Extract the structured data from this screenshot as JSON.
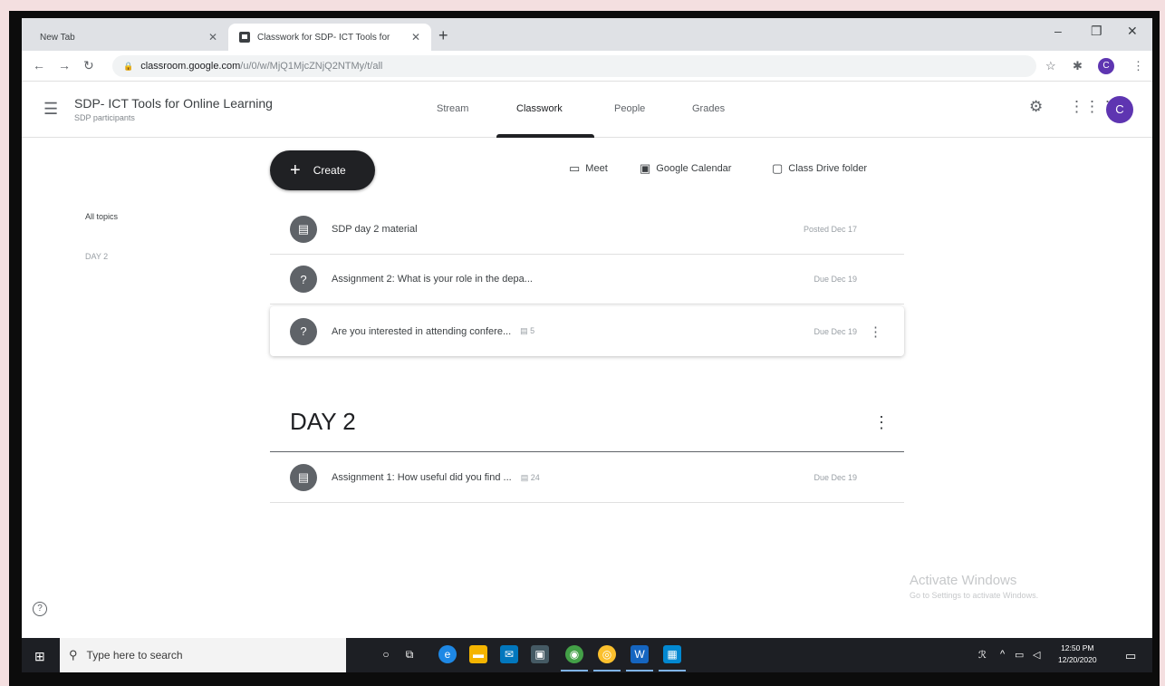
{
  "browser": {
    "tabs": [
      {
        "title": "New Tab"
      },
      {
        "title": "Classwork for SDP- ICT Tools for"
      }
    ],
    "url_host": "classroom.google.com",
    "url_path": "/u/0/w/MjQ1MjcZNjQ2NTMy/t/all",
    "profile_initial": "C",
    "window_controls": [
      "–",
      "❐",
      "✕"
    ]
  },
  "header": {
    "class_name": "SDP- ICT Tools for Online Learning",
    "subtitle": "SDP participants",
    "tabs": [
      "Stream",
      "Classwork",
      "People",
      "Grades"
    ],
    "active_tab": "Classwork",
    "avatar_initial": "C"
  },
  "toolbar": {
    "create_label": "Create",
    "meet_label": "Meet",
    "calendar_label": "Google Calendar",
    "drive_label": "Class Drive folder"
  },
  "topics": [
    "All topics",
    "DAY 2"
  ],
  "items": [
    {
      "title": "SDP day 2 material",
      "date": "Posted Dec 17",
      "icon": "material-icon"
    },
    {
      "title": "Assignment 2: What is your role in the depa...",
      "date": "Due Dec 19",
      "icon": "question-icon"
    },
    {
      "title": "Are you interested in attending confere...",
      "count": "5",
      "date": "Due Dec 19",
      "icon": "question-icon"
    }
  ],
  "section": {
    "title": "DAY 2",
    "items": [
      {
        "title": "Assignment 1: How useful did you find ...",
        "count": "24",
        "date": "Due Dec 19",
        "icon": "assignment-icon"
      }
    ]
  },
  "watermark": {
    "line1": "Activate Windows",
    "line2": "Go to Settings to activate Windows."
  },
  "taskbar": {
    "search_placeholder": "Type here to search",
    "time": "12:50 PM",
    "date": "12/20/2020"
  }
}
